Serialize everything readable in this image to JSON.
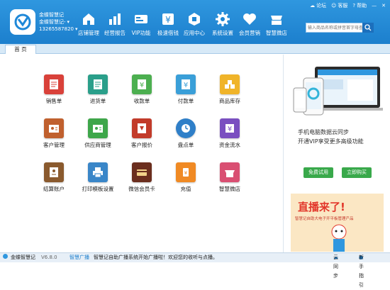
{
  "header": {
    "user_name": "金蝶智慧记",
    "user_shop": "金蝶智慧记-",
    "user_phone": "13265587820",
    "nav": [
      {
        "label": "店铺管理",
        "icon": "store-icon"
      },
      {
        "label": "经营报告",
        "icon": "report-icon"
      },
      {
        "label": "VIP功能",
        "icon": "vip-card-icon"
      },
      {
        "label": "极速借钱",
        "icon": "money-icon"
      },
      {
        "label": "应用中心",
        "icon": "app-center-icon"
      },
      {
        "label": "系统设置",
        "icon": "gear-icon"
      },
      {
        "label": "会员营销",
        "icon": "heart-icon"
      },
      {
        "label": "智慧微店",
        "icon": "micro-store-icon"
      }
    ],
    "links": [
      "论坛",
      "客服",
      "帮助"
    ],
    "search_placeholder": "输入商品名称或拼音首字母查询"
  },
  "tab": {
    "label": "首 页"
  },
  "grid": [
    {
      "label": "销售单",
      "icon": "sales-order-icon",
      "color": "#d9413a"
    },
    {
      "label": "进货单",
      "icon": "purchase-order-icon",
      "color": "#2a9f8a"
    },
    {
      "label": "收款单",
      "icon": "receipt-icon",
      "color": "#4caf50"
    },
    {
      "label": "付款单",
      "icon": "payment-icon",
      "color": "#3a9fd8"
    },
    {
      "label": "商品库存",
      "icon": "inventory-icon",
      "color": "#f0b429"
    },
    {
      "label": "客户管理",
      "icon": "customer-icon",
      "color": "#c0602e"
    },
    {
      "label": "供应商管理",
      "icon": "supplier-icon",
      "color": "#3ea64a"
    },
    {
      "label": "客户报价",
      "icon": "quote-icon",
      "color": "#c23b2a"
    },
    {
      "label": "盘点单",
      "icon": "stocktake-icon",
      "color": "#2f7fc8"
    },
    {
      "label": "资金流水",
      "icon": "cash-flow-icon",
      "color": "#7a4fc0"
    },
    {
      "label": "结算账户",
      "icon": "account-icon",
      "color": "#8a5a2e"
    },
    {
      "label": "打印模板设置",
      "icon": "printer-icon",
      "color": "#3a86c8"
    },
    {
      "label": "微信会员卡",
      "icon": "wechat-card-icon",
      "color": "#6b2e1e"
    },
    {
      "label": "充值",
      "icon": "recharge-icon",
      "color": "#f08a24"
    },
    {
      "label": "智慧微店",
      "icon": "micro-store-icon",
      "color": "#d94f72"
    }
  ],
  "side": {
    "promo_line1": "手机电脑数据云同步",
    "promo_line2": "开通VIP享受更多高级功能",
    "btn_trial": "免费试用",
    "btn_buy": "立即购买",
    "banner_title": "直播来了!",
    "banner_sub": "智慧记自助大电子开平板管理产品"
  },
  "status": {
    "app": "金蝶智慧记",
    "version": "V6.8.0",
    "broadcast_label": "智慧广播",
    "message": "智慧记自助广播系统开始广播啦！欢迎您的收听与点播。",
    "cloud": "云同步",
    "help": "新手指引"
  }
}
